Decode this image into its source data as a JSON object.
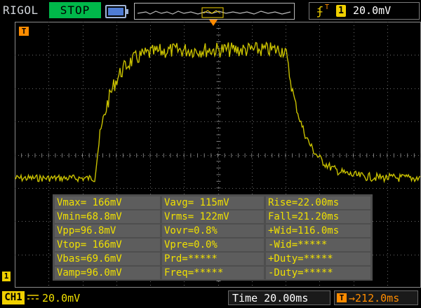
{
  "brand": "RIGOL",
  "run_status": "STOP",
  "trigger": {
    "edge_icon": "rising-edge-icon",
    "edge_glyph": "ʄ",
    "source": "1",
    "level": "20.0mV",
    "position_marker": "T"
  },
  "markers": {
    "trigger_level": "T",
    "channel_ground": "1"
  },
  "measurements": [
    [
      "Vmax= 166mV",
      "Vavg= 115mV",
      "Rise=22.00ms"
    ],
    [
      "Vmin=68.8mV",
      "Vrms= 122mV",
      "Fall=21.20ms"
    ],
    [
      "Vpp=96.8mV",
      "Vovr=0.8%",
      "+Wid=116.0ms"
    ],
    [
      "Vtop= 166mV",
      "Vpre=0.0%",
      "-Wid=*****"
    ],
    [
      "Vbas=69.6mV",
      "Prd=*****",
      "+Duty=*****"
    ],
    [
      "Vamp=96.0mV",
      "Freq=*****",
      "-Duty=*****"
    ]
  ],
  "channel": {
    "label": "CH1",
    "scale": "20.0mV",
    "color": "#f0d000"
  },
  "timebase": "Time 20.00ms",
  "trigger_delay": {
    "icon": "T",
    "value": "212.0ms"
  },
  "colors": {
    "trace": "#c8c000",
    "status_stop": "#00b84a",
    "trigger": "#ff8c00",
    "measure_text": "#f0e000"
  }
}
